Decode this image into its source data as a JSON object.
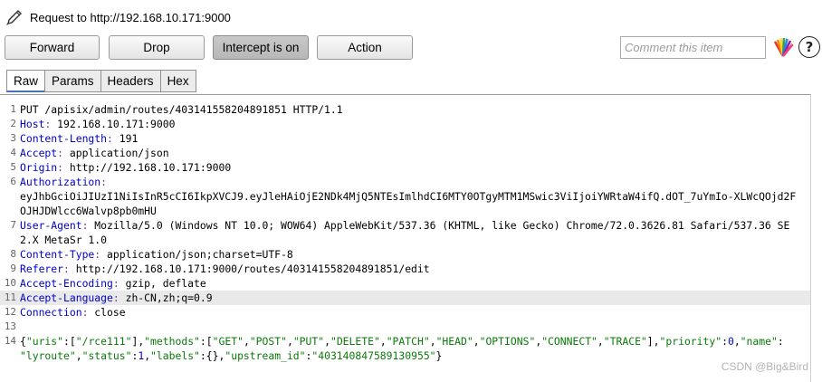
{
  "window": {
    "title": "Request to http://192.168.10.171:9000"
  },
  "toolbar": {
    "forward_label": "Forward",
    "drop_label": "Drop",
    "intercept_label": "Intercept is on",
    "action_label": "Action",
    "comment_placeholder": "Comment this item"
  },
  "icons": {
    "title": "pencil-icon",
    "highlight": "color-highlight-icon",
    "help": "help-icon"
  },
  "tabs": [
    {
      "label": "Raw",
      "selected": true
    },
    {
      "label": "Params"
    },
    {
      "label": "Headers"
    },
    {
      "label": "Hex"
    }
  ],
  "colors": {
    "header_name": "#0000c8",
    "json_string": "#0a7a0a",
    "json_key": "#0000d0"
  },
  "request": {
    "lines": [
      {
        "n": "1",
        "text": "PUT /apisix/admin/routes/403141558204891851 HTTP/1.1"
      },
      {
        "n": "2",
        "name": "Host",
        "value": " 192.168.10.171:9000"
      },
      {
        "n": "3",
        "name": "Content-Length",
        "value": " 191"
      },
      {
        "n": "4",
        "name": "Accept",
        "value": " application/json"
      },
      {
        "n": "5",
        "name": "Origin",
        "value": " http://192.168.10.171:9000"
      },
      {
        "n": "6",
        "name": "Authorization",
        "value": ""
      },
      {
        "n": "",
        "text": "eyJhbGciOiJIUzI1NiIsInR5cCI6IkpXVCJ9.eyJleHAiOjE2NDk4MjQ5NTEsImlhdCI6MTY0OTgyMTM1MSwic3ViIjoiYWRtaW4ifQ.dOT_7uYmIo-XLWcQOjd2F"
      },
      {
        "n": "",
        "text": "OJHJDWlcc6Walvp8pb0mHU"
      },
      {
        "n": "7",
        "name": "User-Agent",
        "value": " Mozilla/5.0 (Windows NT 10.0; WOW64) AppleWebKit/537.36 (KHTML, like Gecko) Chrome/72.0.3626.81 Safari/537.36 SE"
      },
      {
        "n": "",
        "text": "2.X MetaSr 1.0"
      },
      {
        "n": "8",
        "name": "Content-Type",
        "value": " application/json;charset=UTF-8"
      },
      {
        "n": "9",
        "name": "Referer",
        "value": " http://192.168.10.171:9000/routes/403141558204891851/edit"
      },
      {
        "n": "10",
        "name": "Accept-Encoding",
        "value": " gzip, deflate"
      },
      {
        "n": "11",
        "name": "Accept-Language",
        "value": " zh-CN,zh;q=0.9",
        "highlight": true
      },
      {
        "n": "12",
        "name": "Connection",
        "value": " close"
      },
      {
        "n": "13",
        "text": ""
      },
      {
        "n": "14",
        "json": [
          [
            "p",
            "{"
          ],
          [
            "s",
            "\"uris\""
          ],
          [
            "p",
            ":["
          ],
          [
            "s",
            "\"/rce111\""
          ],
          [
            "p",
            "],"
          ],
          [
            "s",
            "\"methods\""
          ],
          [
            "p",
            ":["
          ],
          [
            "s",
            "\"GET\""
          ],
          [
            "p",
            ","
          ],
          [
            "s",
            "\"POST\""
          ],
          [
            "p",
            ","
          ],
          [
            "s",
            "\"PUT\""
          ],
          [
            "p",
            ","
          ],
          [
            "s",
            "\"DELETE\""
          ],
          [
            "p",
            ","
          ],
          [
            "s",
            "\"PATCH\""
          ],
          [
            "p",
            ","
          ],
          [
            "s",
            "\"HEAD\""
          ],
          [
            "p",
            ","
          ],
          [
            "s",
            "\"OPTIONS\""
          ],
          [
            "p",
            ","
          ],
          [
            "s",
            "\"CONNECT\""
          ],
          [
            "p",
            ","
          ],
          [
            "s",
            "\"TRACE\""
          ],
          [
            "p",
            "],"
          ],
          [
            "s",
            "\"priority\""
          ],
          [
            "p",
            ":"
          ],
          [
            "n",
            "0"
          ],
          [
            "p",
            ","
          ],
          [
            "s",
            "\"name\""
          ],
          [
            "p",
            ":"
          ]
        ]
      },
      {
        "n": "",
        "json": [
          [
            "s",
            "\"lyroute\""
          ],
          [
            "p",
            ","
          ],
          [
            "s",
            "\"status\""
          ],
          [
            "p",
            ":"
          ],
          [
            "n",
            "1"
          ],
          [
            "p",
            ","
          ],
          [
            "s",
            "\"labels\""
          ],
          [
            "p",
            ":{},"
          ],
          [
            "s",
            "\"upstream_id\""
          ],
          [
            "p",
            ":"
          ],
          [
            "s",
            "\"403140847589130955\""
          ],
          [
            "p",
            "}"
          ]
        ]
      }
    ]
  },
  "watermark": "CSDN @Big&Bird"
}
